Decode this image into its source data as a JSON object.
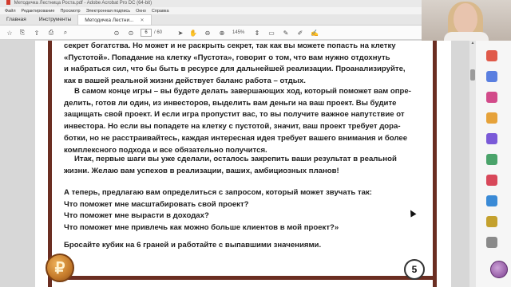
{
  "window": {
    "title": "Методичка Лестница Роста.pdf - Adobe Acrobat Pro DC (64-bit)"
  },
  "menu": [
    "Файл",
    "Редактирование",
    "Просмотр",
    "Электронная подпись",
    "Окно",
    "Справка"
  ],
  "tabs": {
    "home": "Главная",
    "tools": "Инструменты",
    "document": "Методичка Лестни..."
  },
  "toolbar": {
    "current_page": "6",
    "total_pages": "/ 60",
    "zoom": "145%"
  },
  "document": {
    "paragraphs": [
      [
        "секрет богатства. Но может и не раскрыть секрет, так как вы можете попасть на клетку",
        "«Пустотой». Попадание на клетку «Пустота», говорит о том, что вам нужно отдохнуть",
        "и набраться сил, что бы быть в ресурсе для дальнейшей реализации. Проанализируйте,",
        "как в вашей реальной жизни действует баланс работа – отдых."
      ],
      [
        "В самом конце игры – вы будете делать завершающих ход, который поможет вам опре-",
        "делить, готов ли один, из инвесторов, выделить вам деньги на ваш проект. Вы будите",
        "защищать свой проект. И если игра пропустит вас, то вы получите важное напутствие от",
        "инвестора. Но если вы попадете на клетку с пустотой, значит, ваш проект требует дора-",
        "ботки, но не расстраивайтесь, каждая интересная идея требует вашего внимания и более",
        "комплексного подхода и все обязательно получится."
      ],
      [
        "Итак, первые шаги вы уже сделали, осталось закрепить ваши результат в реальной",
        "жизни. Желаю вам успехов в реализации, ваших, амбициозных планов!"
      ],
      [
        "А теперь, предлагаю вам определиться с запросом, который может звучать так:",
        "Что поможет мне масштабировать свой проект?",
        "Что поможет мне вырасти в доходах?",
        "Что поможет мне привлечь как можно больше клиентов в мой проект?»"
      ],
      [
        "Бросайте кубик на 6 граней и работайте с выпавшими значениями."
      ]
    ],
    "page_number": "5",
    "coin_symbol": "₽"
  },
  "colors": {
    "border": "#6b2e22",
    "coin": "#c47a2a"
  }
}
